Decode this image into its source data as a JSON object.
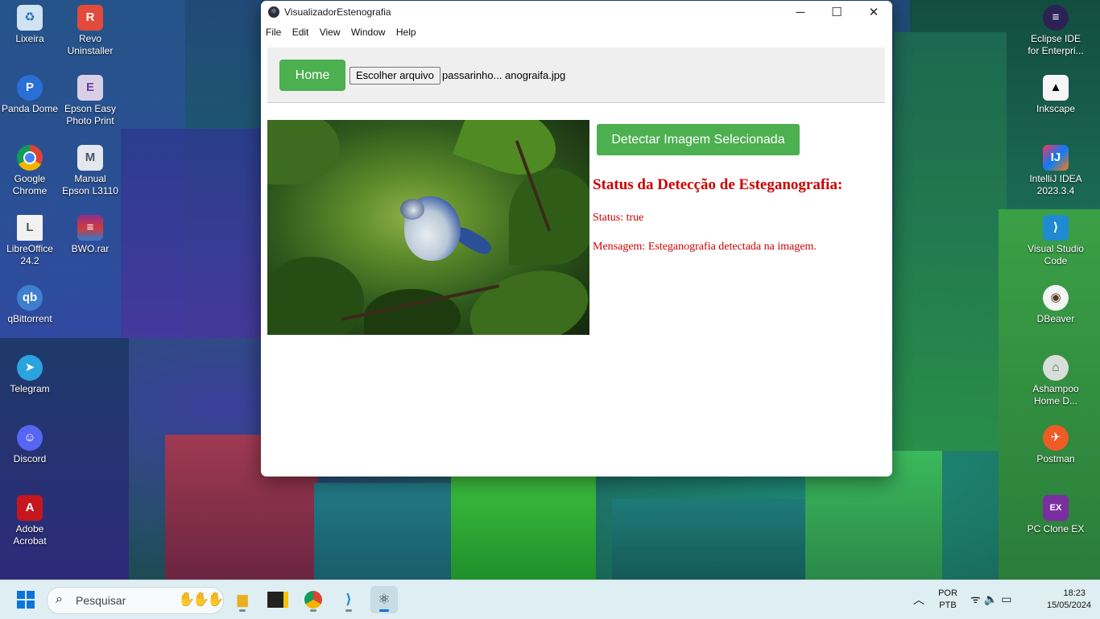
{
  "window": {
    "title": "VisualizadorEstenografia",
    "controls": {
      "minimize": "─",
      "maximize": "☐",
      "close": "✕"
    }
  },
  "menu": [
    "File",
    "Edit",
    "View",
    "Window",
    "Help"
  ],
  "toolbar": {
    "home_label": "Home",
    "file_button_label": "Escolher arquivo",
    "file_name": "passarinho... anograifa.jpg"
  },
  "detection": {
    "button_label": "Detectar Imagem Selecionada",
    "heading": "Status da Detecção de Esteganografia:",
    "status": "Status: true",
    "message": "Mensagem: Esteganografia detectada na imagem."
  },
  "desktop_icons_left": [
    {
      "label": "Lixeira",
      "icon": "recycle-bin-icon"
    },
    {
      "label": "Revo Uninstaller",
      "icon": "revo-icon"
    },
    {
      "label": "Panda Dome",
      "icon": "panda-icon"
    },
    {
      "label": "Epson Easy Photo Print",
      "icon": "epson-photo-icon"
    },
    {
      "label": "Google Chrome",
      "icon": "chrome-icon"
    },
    {
      "label": "Manual Epson L3110",
      "icon": "manual-icon"
    },
    {
      "label": "LibreOffice 24.2",
      "icon": "libreoffice-icon"
    },
    {
      "label": "BWO.rar",
      "icon": "rar-icon"
    },
    {
      "label": "qBittorrent",
      "icon": "qbittorrent-icon"
    },
    {
      "label": "Telegram",
      "icon": "telegram-icon"
    },
    {
      "label": "Discord",
      "icon": "discord-icon"
    },
    {
      "label": "Adobe Acrobat",
      "icon": "acrobat-icon"
    }
  ],
  "desktop_icons_right": [
    {
      "label": "Eclipse IDE for Enterpri...",
      "icon": "eclipse-icon"
    },
    {
      "label": "Inkscape",
      "icon": "inkscape-icon"
    },
    {
      "label": "IntelliJ IDEA 2023.3.4",
      "icon": "intellij-icon"
    },
    {
      "label": "Visual Studio Code",
      "icon": "vscode-icon"
    },
    {
      "label": "DBeaver",
      "icon": "dbeaver-icon"
    },
    {
      "label": "Ashampoo Home D...",
      "icon": "ashampoo-icon"
    },
    {
      "label": "Postman",
      "icon": "postman-icon"
    },
    {
      "label": "PC Clone EX",
      "icon": "pcclone-icon"
    }
  ],
  "taskbar": {
    "search_placeholder": "Pesquisar",
    "language": "POR",
    "keyboard": "PTB",
    "time": "18:23",
    "date": "15/05/2024"
  }
}
